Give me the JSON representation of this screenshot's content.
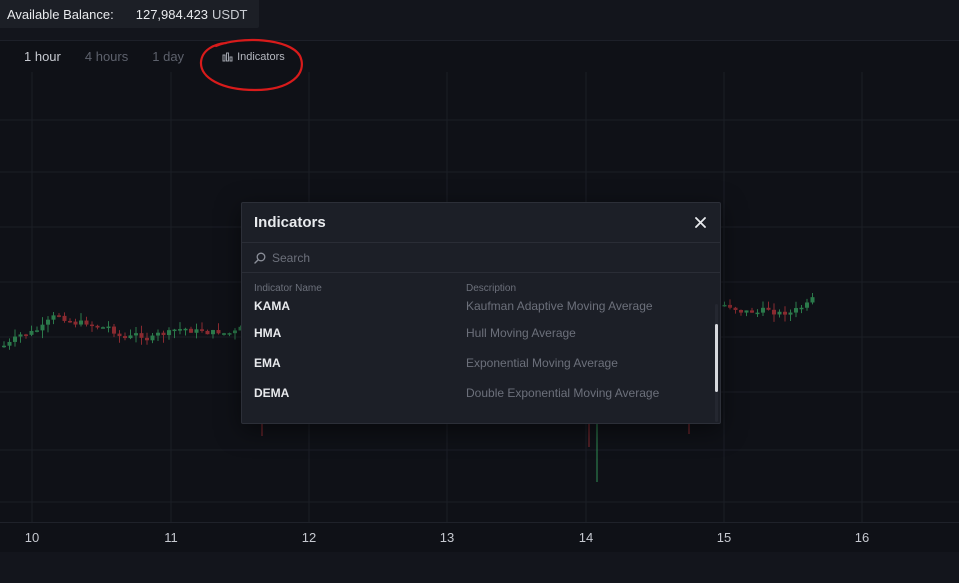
{
  "balance": {
    "label": "Available Balance:",
    "value": "127,984.423",
    "unit": "USDT"
  },
  "toolbar": {
    "timeframes": [
      {
        "label": "1 hour",
        "active": true
      },
      {
        "label": "4 hours",
        "active": false
      },
      {
        "label": "1 day",
        "active": false
      }
    ],
    "indicators_label": "Indicators",
    "indicators_icon": "bar-chart-icon"
  },
  "chart": {
    "x_ticks": [
      "10",
      "11",
      "12",
      "13",
      "14",
      "15",
      "16"
    ],
    "up_color": "#2b7a4b",
    "down_color": "#8a2a30"
  },
  "modal": {
    "title": "Indicators",
    "close_icon": "close-icon",
    "search_placeholder": "Search",
    "search_icon": "search-icon",
    "columns": {
      "name": "Indicator Name",
      "description": "Description"
    },
    "rows": [
      {
        "name": "KAMA",
        "description": "Kaufman Adaptive Moving Average"
      },
      {
        "name": "HMA",
        "description": "Hull Moving Average"
      },
      {
        "name": "EMA",
        "description": "Exponential Moving Average"
      },
      {
        "name": "DEMA",
        "description": "Double Exponential Moving Average"
      }
    ]
  },
  "annotation": {
    "color": "#d81b1b"
  }
}
